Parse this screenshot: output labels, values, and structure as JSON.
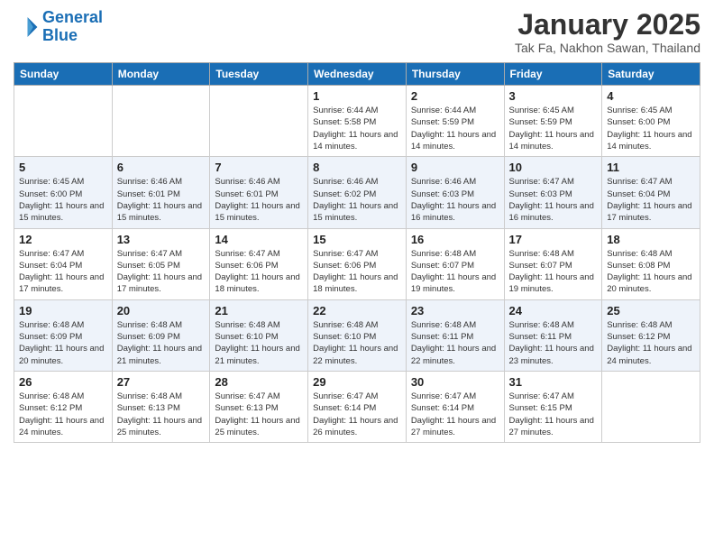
{
  "logo": {
    "line1": "General",
    "line2": "Blue"
  },
  "title": "January 2025",
  "location": "Tak Fa, Nakhon Sawan, Thailand",
  "weekdays": [
    "Sunday",
    "Monday",
    "Tuesday",
    "Wednesday",
    "Thursday",
    "Friday",
    "Saturday"
  ],
  "weeks": [
    [
      {
        "day": "",
        "sunrise": "",
        "sunset": "",
        "daylight": ""
      },
      {
        "day": "",
        "sunrise": "",
        "sunset": "",
        "daylight": ""
      },
      {
        "day": "",
        "sunrise": "",
        "sunset": "",
        "daylight": ""
      },
      {
        "day": "1",
        "sunrise": "Sunrise: 6:44 AM",
        "sunset": "Sunset: 5:58 PM",
        "daylight": "Daylight: 11 hours and 14 minutes."
      },
      {
        "day": "2",
        "sunrise": "Sunrise: 6:44 AM",
        "sunset": "Sunset: 5:59 PM",
        "daylight": "Daylight: 11 hours and 14 minutes."
      },
      {
        "day": "3",
        "sunrise": "Sunrise: 6:45 AM",
        "sunset": "Sunset: 5:59 PM",
        "daylight": "Daylight: 11 hours and 14 minutes."
      },
      {
        "day": "4",
        "sunrise": "Sunrise: 6:45 AM",
        "sunset": "Sunset: 6:00 PM",
        "daylight": "Daylight: 11 hours and 14 minutes."
      }
    ],
    [
      {
        "day": "5",
        "sunrise": "Sunrise: 6:45 AM",
        "sunset": "Sunset: 6:00 PM",
        "daylight": "Daylight: 11 hours and 15 minutes."
      },
      {
        "day": "6",
        "sunrise": "Sunrise: 6:46 AM",
        "sunset": "Sunset: 6:01 PM",
        "daylight": "Daylight: 11 hours and 15 minutes."
      },
      {
        "day": "7",
        "sunrise": "Sunrise: 6:46 AM",
        "sunset": "Sunset: 6:01 PM",
        "daylight": "Daylight: 11 hours and 15 minutes."
      },
      {
        "day": "8",
        "sunrise": "Sunrise: 6:46 AM",
        "sunset": "Sunset: 6:02 PM",
        "daylight": "Daylight: 11 hours and 15 minutes."
      },
      {
        "day": "9",
        "sunrise": "Sunrise: 6:46 AM",
        "sunset": "Sunset: 6:03 PM",
        "daylight": "Daylight: 11 hours and 16 minutes."
      },
      {
        "day": "10",
        "sunrise": "Sunrise: 6:47 AM",
        "sunset": "Sunset: 6:03 PM",
        "daylight": "Daylight: 11 hours and 16 minutes."
      },
      {
        "day": "11",
        "sunrise": "Sunrise: 6:47 AM",
        "sunset": "Sunset: 6:04 PM",
        "daylight": "Daylight: 11 hours and 17 minutes."
      }
    ],
    [
      {
        "day": "12",
        "sunrise": "Sunrise: 6:47 AM",
        "sunset": "Sunset: 6:04 PM",
        "daylight": "Daylight: 11 hours and 17 minutes."
      },
      {
        "day": "13",
        "sunrise": "Sunrise: 6:47 AM",
        "sunset": "Sunset: 6:05 PM",
        "daylight": "Daylight: 11 hours and 17 minutes."
      },
      {
        "day": "14",
        "sunrise": "Sunrise: 6:47 AM",
        "sunset": "Sunset: 6:06 PM",
        "daylight": "Daylight: 11 hours and 18 minutes."
      },
      {
        "day": "15",
        "sunrise": "Sunrise: 6:47 AM",
        "sunset": "Sunset: 6:06 PM",
        "daylight": "Daylight: 11 hours and 18 minutes."
      },
      {
        "day": "16",
        "sunrise": "Sunrise: 6:48 AM",
        "sunset": "Sunset: 6:07 PM",
        "daylight": "Daylight: 11 hours and 19 minutes."
      },
      {
        "day": "17",
        "sunrise": "Sunrise: 6:48 AM",
        "sunset": "Sunset: 6:07 PM",
        "daylight": "Daylight: 11 hours and 19 minutes."
      },
      {
        "day": "18",
        "sunrise": "Sunrise: 6:48 AM",
        "sunset": "Sunset: 6:08 PM",
        "daylight": "Daylight: 11 hours and 20 minutes."
      }
    ],
    [
      {
        "day": "19",
        "sunrise": "Sunrise: 6:48 AM",
        "sunset": "Sunset: 6:09 PM",
        "daylight": "Daylight: 11 hours and 20 minutes."
      },
      {
        "day": "20",
        "sunrise": "Sunrise: 6:48 AM",
        "sunset": "Sunset: 6:09 PM",
        "daylight": "Daylight: 11 hours and 21 minutes."
      },
      {
        "day": "21",
        "sunrise": "Sunrise: 6:48 AM",
        "sunset": "Sunset: 6:10 PM",
        "daylight": "Daylight: 11 hours and 21 minutes."
      },
      {
        "day": "22",
        "sunrise": "Sunrise: 6:48 AM",
        "sunset": "Sunset: 6:10 PM",
        "daylight": "Daylight: 11 hours and 22 minutes."
      },
      {
        "day": "23",
        "sunrise": "Sunrise: 6:48 AM",
        "sunset": "Sunset: 6:11 PM",
        "daylight": "Daylight: 11 hours and 22 minutes."
      },
      {
        "day": "24",
        "sunrise": "Sunrise: 6:48 AM",
        "sunset": "Sunset: 6:11 PM",
        "daylight": "Daylight: 11 hours and 23 minutes."
      },
      {
        "day": "25",
        "sunrise": "Sunrise: 6:48 AM",
        "sunset": "Sunset: 6:12 PM",
        "daylight": "Daylight: 11 hours and 24 minutes."
      }
    ],
    [
      {
        "day": "26",
        "sunrise": "Sunrise: 6:48 AM",
        "sunset": "Sunset: 6:12 PM",
        "daylight": "Daylight: 11 hours and 24 minutes."
      },
      {
        "day": "27",
        "sunrise": "Sunrise: 6:48 AM",
        "sunset": "Sunset: 6:13 PM",
        "daylight": "Daylight: 11 hours and 25 minutes."
      },
      {
        "day": "28",
        "sunrise": "Sunrise: 6:47 AM",
        "sunset": "Sunset: 6:13 PM",
        "daylight": "Daylight: 11 hours and 25 minutes."
      },
      {
        "day": "29",
        "sunrise": "Sunrise: 6:47 AM",
        "sunset": "Sunset: 6:14 PM",
        "daylight": "Daylight: 11 hours and 26 minutes."
      },
      {
        "day": "30",
        "sunrise": "Sunrise: 6:47 AM",
        "sunset": "Sunset: 6:14 PM",
        "daylight": "Daylight: 11 hours and 27 minutes."
      },
      {
        "day": "31",
        "sunrise": "Sunrise: 6:47 AM",
        "sunset": "Sunset: 6:15 PM",
        "daylight": "Daylight: 11 hours and 27 minutes."
      },
      {
        "day": "",
        "sunrise": "",
        "sunset": "",
        "daylight": ""
      }
    ]
  ]
}
